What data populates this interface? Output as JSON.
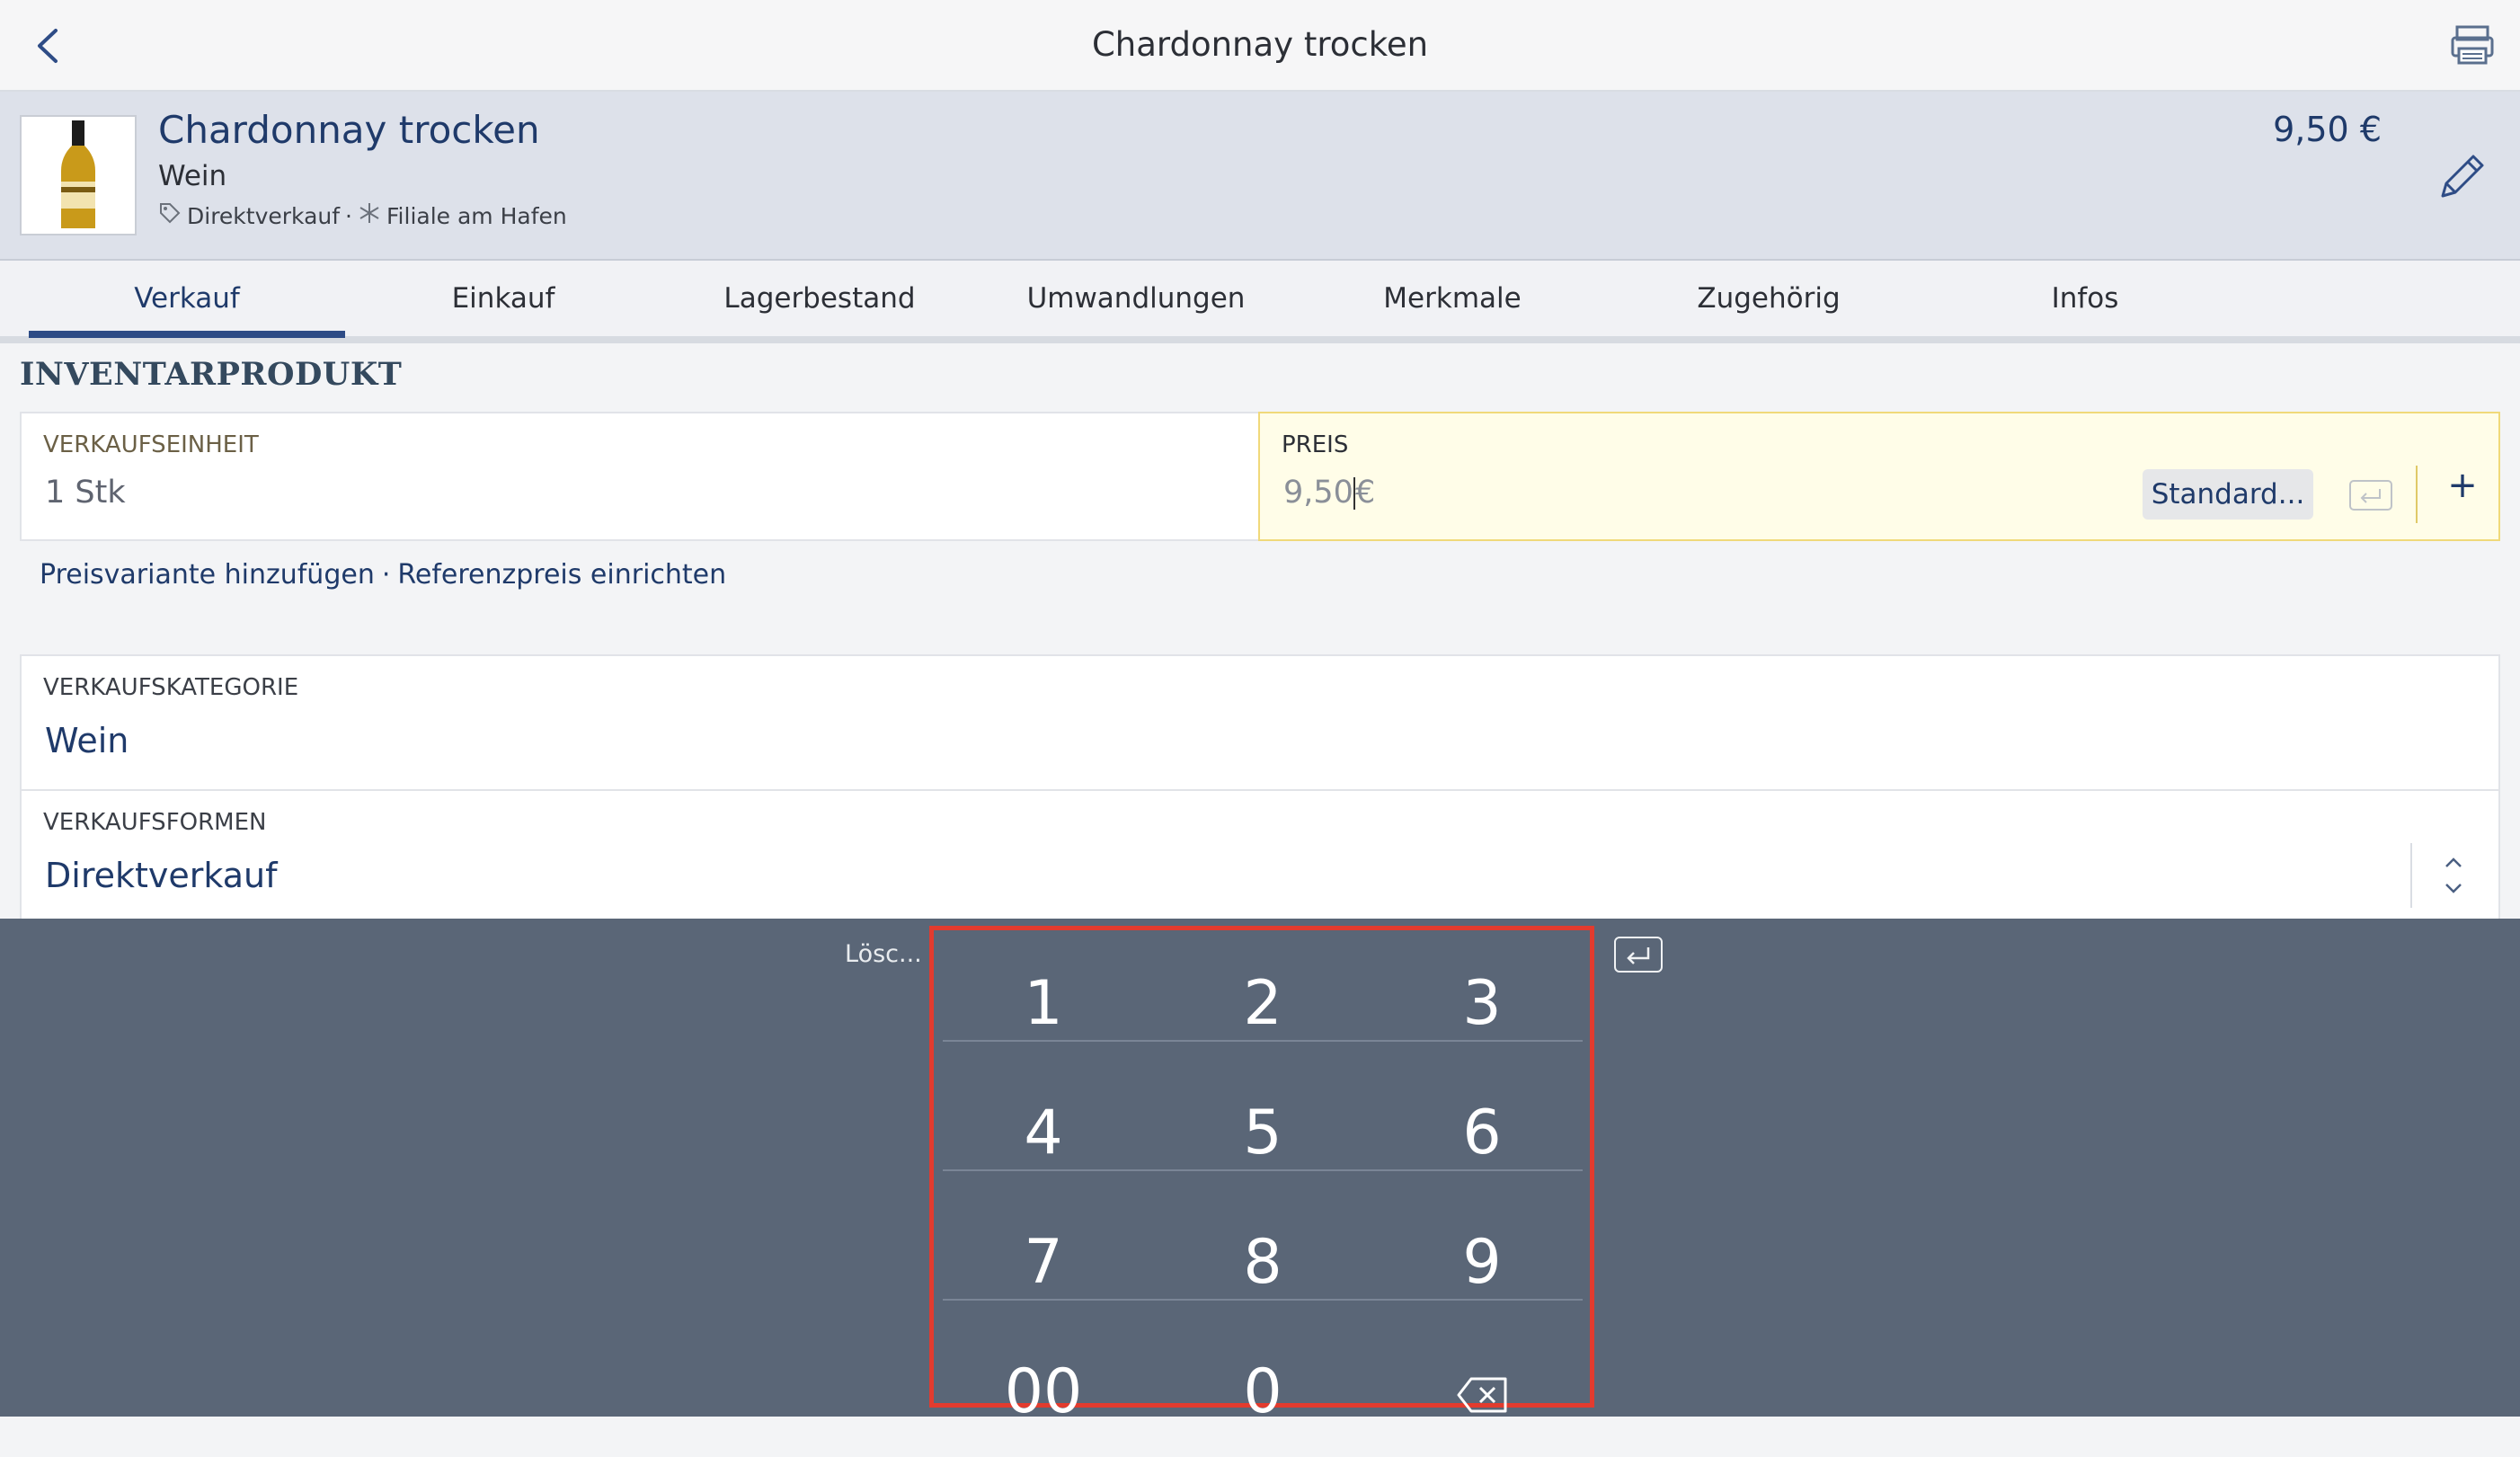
{
  "app": {
    "title": "Chardonnay trocken"
  },
  "product": {
    "name": "Chardonnay trocken",
    "category": "Wein",
    "channel": "Direktverkauf",
    "separator": "·",
    "location": "Filiale am Hafen",
    "price": "9,50 €"
  },
  "tabs": [
    {
      "label": "Verkauf",
      "active": true
    },
    {
      "label": "Einkauf",
      "active": false
    },
    {
      "label": "Lagerbestand",
      "active": false
    },
    {
      "label": "Umwandlungen",
      "active": false
    },
    {
      "label": "Merkmale",
      "active": false
    },
    {
      "label": "Zugehörig",
      "active": false
    },
    {
      "label": "Infos",
      "active": false
    }
  ],
  "section": {
    "title": "INVENTARPRODUKT"
  },
  "fields": {
    "unit": {
      "label": "VERKAUFSEINHEIT",
      "value": "1 Stk"
    },
    "price": {
      "label": "PREIS",
      "value": "9,50",
      "currency": "€",
      "default_button": "Standard...",
      "add_button": "+"
    },
    "category": {
      "label": "VERKAUFSKATEGORIE",
      "value": "Wein"
    },
    "sales_form": {
      "label": "VERKAUFSFORMEN",
      "value": "Direktverkauf"
    }
  },
  "links": {
    "add_variant": "Preisvariante hinzufügen",
    "separator": "·",
    "reference_price": "Referenzpreis einrichten"
  },
  "keypad": {
    "clear_label": "Lösc...",
    "keys": [
      "1",
      "2",
      "3",
      "4",
      "5",
      "6",
      "7",
      "8",
      "9",
      "00",
      "0"
    ],
    "backspace_icon": "backspace-icon"
  },
  "colors": {
    "accent": "#1f3a6a",
    "keypad_bg": "#5a6677",
    "highlight_border": "#e23b2e",
    "active_field_bg": "#fffde8"
  }
}
